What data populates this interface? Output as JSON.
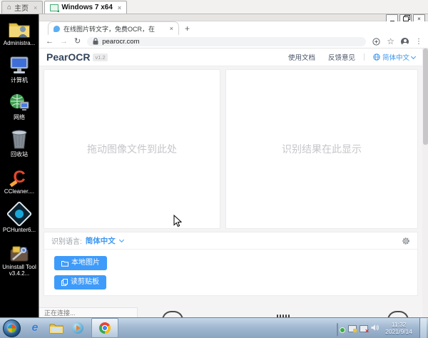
{
  "console": {
    "home_tab": "主页",
    "vm_tab": "Windows 7 x64"
  },
  "desktop": {
    "icons": [
      {
        "label": "Administra..."
      },
      {
        "label": "计算机"
      },
      {
        "label": "网络"
      },
      {
        "label": "回收站"
      },
      {
        "label": "CCleaner...."
      },
      {
        "label": "PCHunter6..."
      },
      {
        "label": "Uninstall Tool v3.4.2..."
      }
    ]
  },
  "browser": {
    "tab_title": "在线图片转文字，免费OCR，在",
    "new_tab": "+",
    "url": "pearocr.com",
    "status": "正在连接..."
  },
  "site": {
    "brand": "PearOCR",
    "version": "v1.2",
    "nav_docs": "使用文档",
    "nav_feedback": "反馈意见",
    "ui_language": "简体中文",
    "drop_hint": "拖动图像文件到此处",
    "result_hint": "识别结果在此显示",
    "ocr_lang_label": "识别语言:",
    "ocr_lang_value": "简体中文",
    "local_image_btn": "本地图片",
    "clipboard_btn": "读剪贴板"
  },
  "taskbar": {
    "time": "11:32",
    "date": "2021/9/14"
  },
  "colors": {
    "accent": "#3e97f0",
    "button_blue": "#3f9bfa"
  }
}
